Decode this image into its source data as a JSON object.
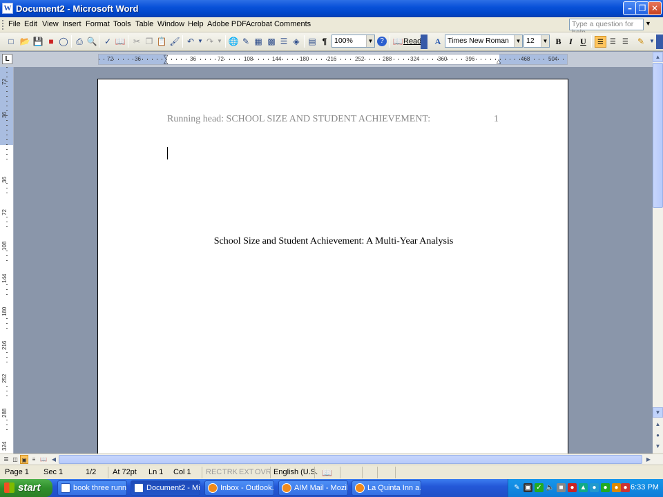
{
  "window": {
    "title": "Document2 - Microsoft Word",
    "icon_glyph": "W",
    "min_icon": "minimize-icon",
    "max_icon": "restore-icon",
    "close_icon": "close-icon"
  },
  "menu": {
    "items": [
      "File",
      "Edit",
      "View",
      "Insert",
      "Format",
      "Tools",
      "Table",
      "Window",
      "Help",
      "Adobe PDF",
      "Acrobat Comments"
    ],
    "help_placeholder": "Type a question for help"
  },
  "toolbar": {
    "zoom": "100%",
    "read_label": "Read",
    "font": "Times New Roman",
    "font_size": "12",
    "bold": "B",
    "italic": "I",
    "underline": "U"
  },
  "ruler": {
    "tab_selector": "L",
    "h_labels": [
      "72",
      "36",
      "36",
      "72",
      "108",
      "144",
      "180",
      "216",
      "252",
      "288",
      "324",
      "360",
      "396",
      "468",
      "504"
    ],
    "v_labels": [
      "72",
      "36",
      "36",
      "72",
      "108",
      "144",
      "180",
      "216",
      "252",
      "288",
      "324"
    ]
  },
  "document": {
    "running_head": "Running head: SCHOOL SIZE AND STUDENT ACHIEVEMENT:",
    "page_number": "1",
    "title": "School Size and Student Achievement: A Multi-Year Analysis"
  },
  "status": {
    "page": "Page 1",
    "sec": "Sec 1",
    "page_of": "1/2",
    "at": "At 72pt",
    "ln": "Ln 1",
    "col": "Col 1",
    "rec": "REC",
    "trk": "TRK",
    "ext": "EXT",
    "ovr": "OVR",
    "language": "English (U.S."
  },
  "taskbar": {
    "start_label": "start",
    "tasks": [
      {
        "label": "book three runn...",
        "icon": "word-doc-icon"
      },
      {
        "label": "Document2 - Mi...",
        "icon": "word-doc-icon"
      },
      {
        "label": "Inbox - Outlook...",
        "icon": "firefox-icon"
      },
      {
        "label": "AIM Mail - Mozilla...",
        "icon": "firefox-icon"
      },
      {
        "label": "La Quinta Inn a...",
        "icon": "firefox-icon"
      }
    ],
    "clock": "6:33 PM"
  },
  "colors": {
    "titlebar": "#0a52d9",
    "chrome": "#ece9d8",
    "workspace": "#8a96aa",
    "taskbar": "#2458d8",
    "start": "#2f8f2b",
    "tray": "#0e7dd8"
  }
}
